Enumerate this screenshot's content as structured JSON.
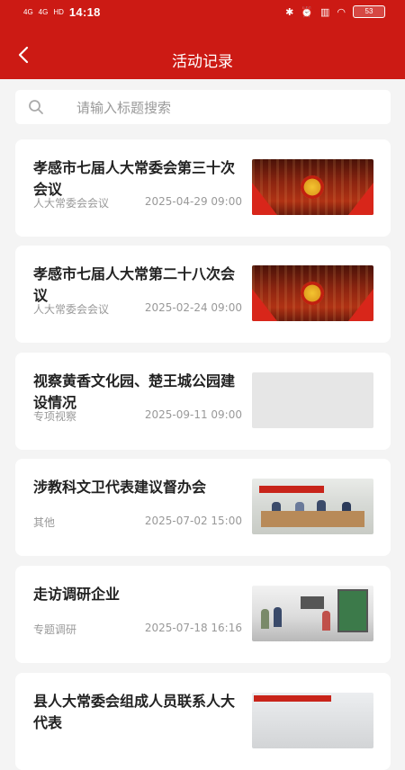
{
  "status_bar": {
    "network_1": "4G",
    "network_2": "4G",
    "hd": "HD",
    "time": "14:18",
    "battery": "53"
  },
  "header": {
    "title": "活动记录"
  },
  "search": {
    "placeholder": "请输入标题搜索"
  },
  "records": [
    {
      "title": "孝感市七届人大常委会第三十次会议",
      "category": "人大常委会会议",
      "datetime": "2025-04-29 09:00",
      "thumbnail": "hall"
    },
    {
      "title": "孝感市七届人大常第二十八次会议",
      "category": "人大常委会会议",
      "datetime": "2025-02-24 09:00",
      "thumbnail": "hall"
    },
    {
      "title": "视察黄香文化园、楚王城公园建设情况",
      "category": "专项视察",
      "datetime": "2025-09-11 09:00",
      "thumbnail": "none"
    },
    {
      "title": "涉教科文卫代表建议督办会",
      "category": "其他",
      "datetime": "2025-07-02 15:00",
      "thumbnail": "meeting"
    },
    {
      "title": "走访调研企业",
      "category": "专题调研",
      "datetime": "2025-07-18 16:16",
      "thumbnail": "visit"
    },
    {
      "title": "县人大常委会组成人员联系人大代表",
      "category": "",
      "datetime": "",
      "thumbnail": "group"
    }
  ],
  "colors": {
    "primary": "#cc1a14",
    "background": "#f4f4f4",
    "card": "#ffffff",
    "title_text": "#222222",
    "meta_text": "#999999"
  },
  "icons": {
    "back": "chevron-left-icon",
    "search": "search-icon"
  }
}
